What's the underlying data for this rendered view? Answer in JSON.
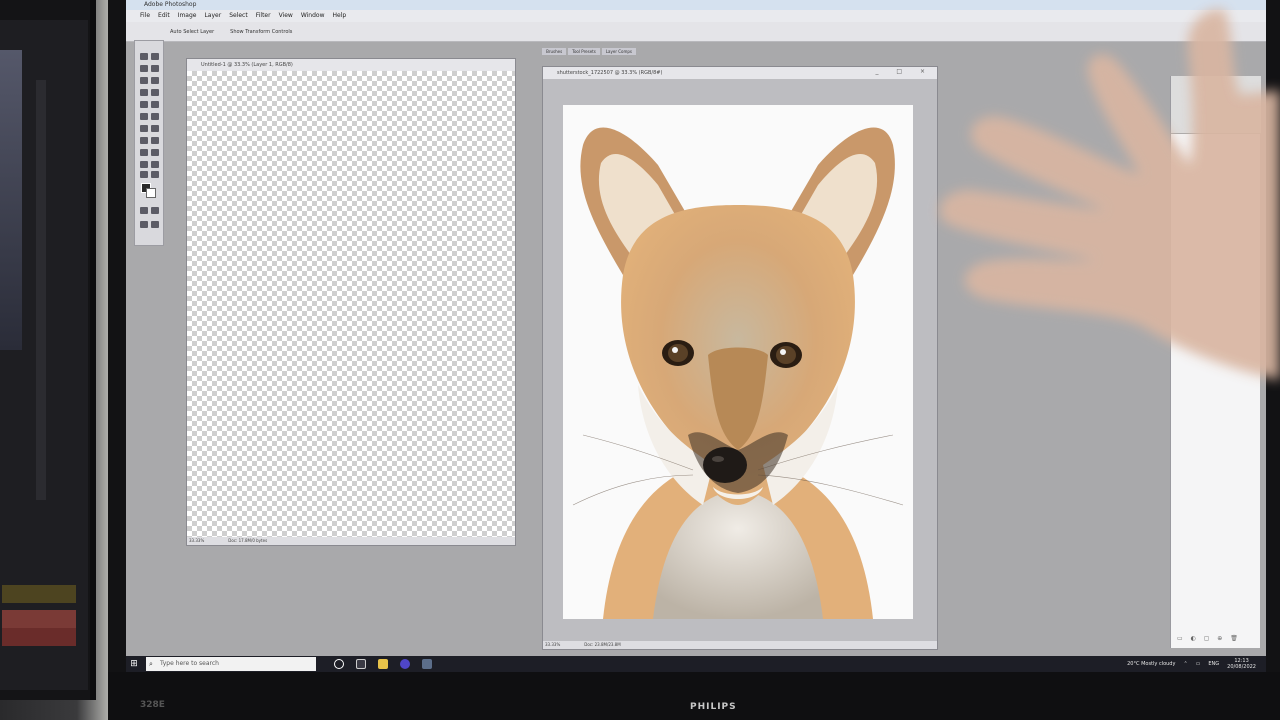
{
  "photoshop": {
    "app_title": "Adobe Photoshop",
    "menus": [
      "File",
      "Edit",
      "Image",
      "Layer",
      "Select",
      "Filter",
      "View",
      "Window",
      "Help"
    ],
    "options": {
      "auto_select": "Auto Select Layer",
      "transform": "Show Transform Controls"
    },
    "palette_tabs": [
      "Brushes",
      "Tool Presets",
      "Layer Comps"
    ],
    "doc_blank": {
      "title": "Untitled-1 @ 33.3% (Layer 1, RGB/8)",
      "zoom": "33.33%",
      "doc_size": "Doc: 17.8M/0 bytes"
    },
    "doc_fox": {
      "title": "shutterstock_1722507 @ 33.3% (RGB/8#)",
      "zoom": "33.33%",
      "doc_size": "Doc: 23.8M/23.8M",
      "win_buttons": "_ □ ×"
    }
  },
  "taskbar": {
    "search_placeholder": "Type here to search",
    "weather": "20°C  Mostly cloudy",
    "language": "ENG",
    "time": "12:13",
    "date": "20/08/2022"
  },
  "monitor": {
    "brand": "PHILIPS",
    "model": "328E"
  },
  "colors": {
    "taskbar": "#1d1e26",
    "canvas_bg": "#a9a9ab",
    "fox_orange": "#d9a063"
  }
}
